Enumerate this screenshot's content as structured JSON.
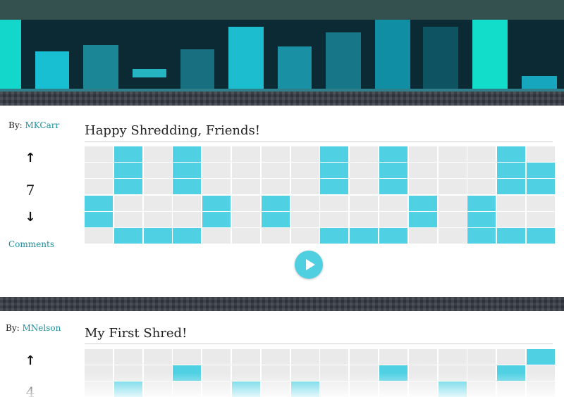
{
  "posts": [
    {
      "by_label": "By:",
      "author": "MKCarr",
      "score": "7",
      "comments_label": "Comments",
      "title": "Happy Shredding, Friends!",
      "grid_rows": [
        "0101000010100010",
        "0101000010100011",
        "0101000010100011",
        "1000101000010100",
        "1000101000010100",
        "0111000011100111"
      ],
      "has_play_button": true
    },
    {
      "by_label": "By:",
      "author": "MNelson",
      "score": "4",
      "title": "My First Shred!",
      "grid_rows": [
        "0000000000000001",
        "0001000000100010",
        "0100010100001000"
      ]
    }
  ],
  "icons": {
    "upvote": "arrow-up-icon",
    "downvote": "arrow-down-icon",
    "play": "play-icon"
  },
  "colors": {
    "accent": "#4fd0e3",
    "cell_off": "#eaeaea",
    "link": "#1e8f9c",
    "topbar": "#34504f"
  }
}
